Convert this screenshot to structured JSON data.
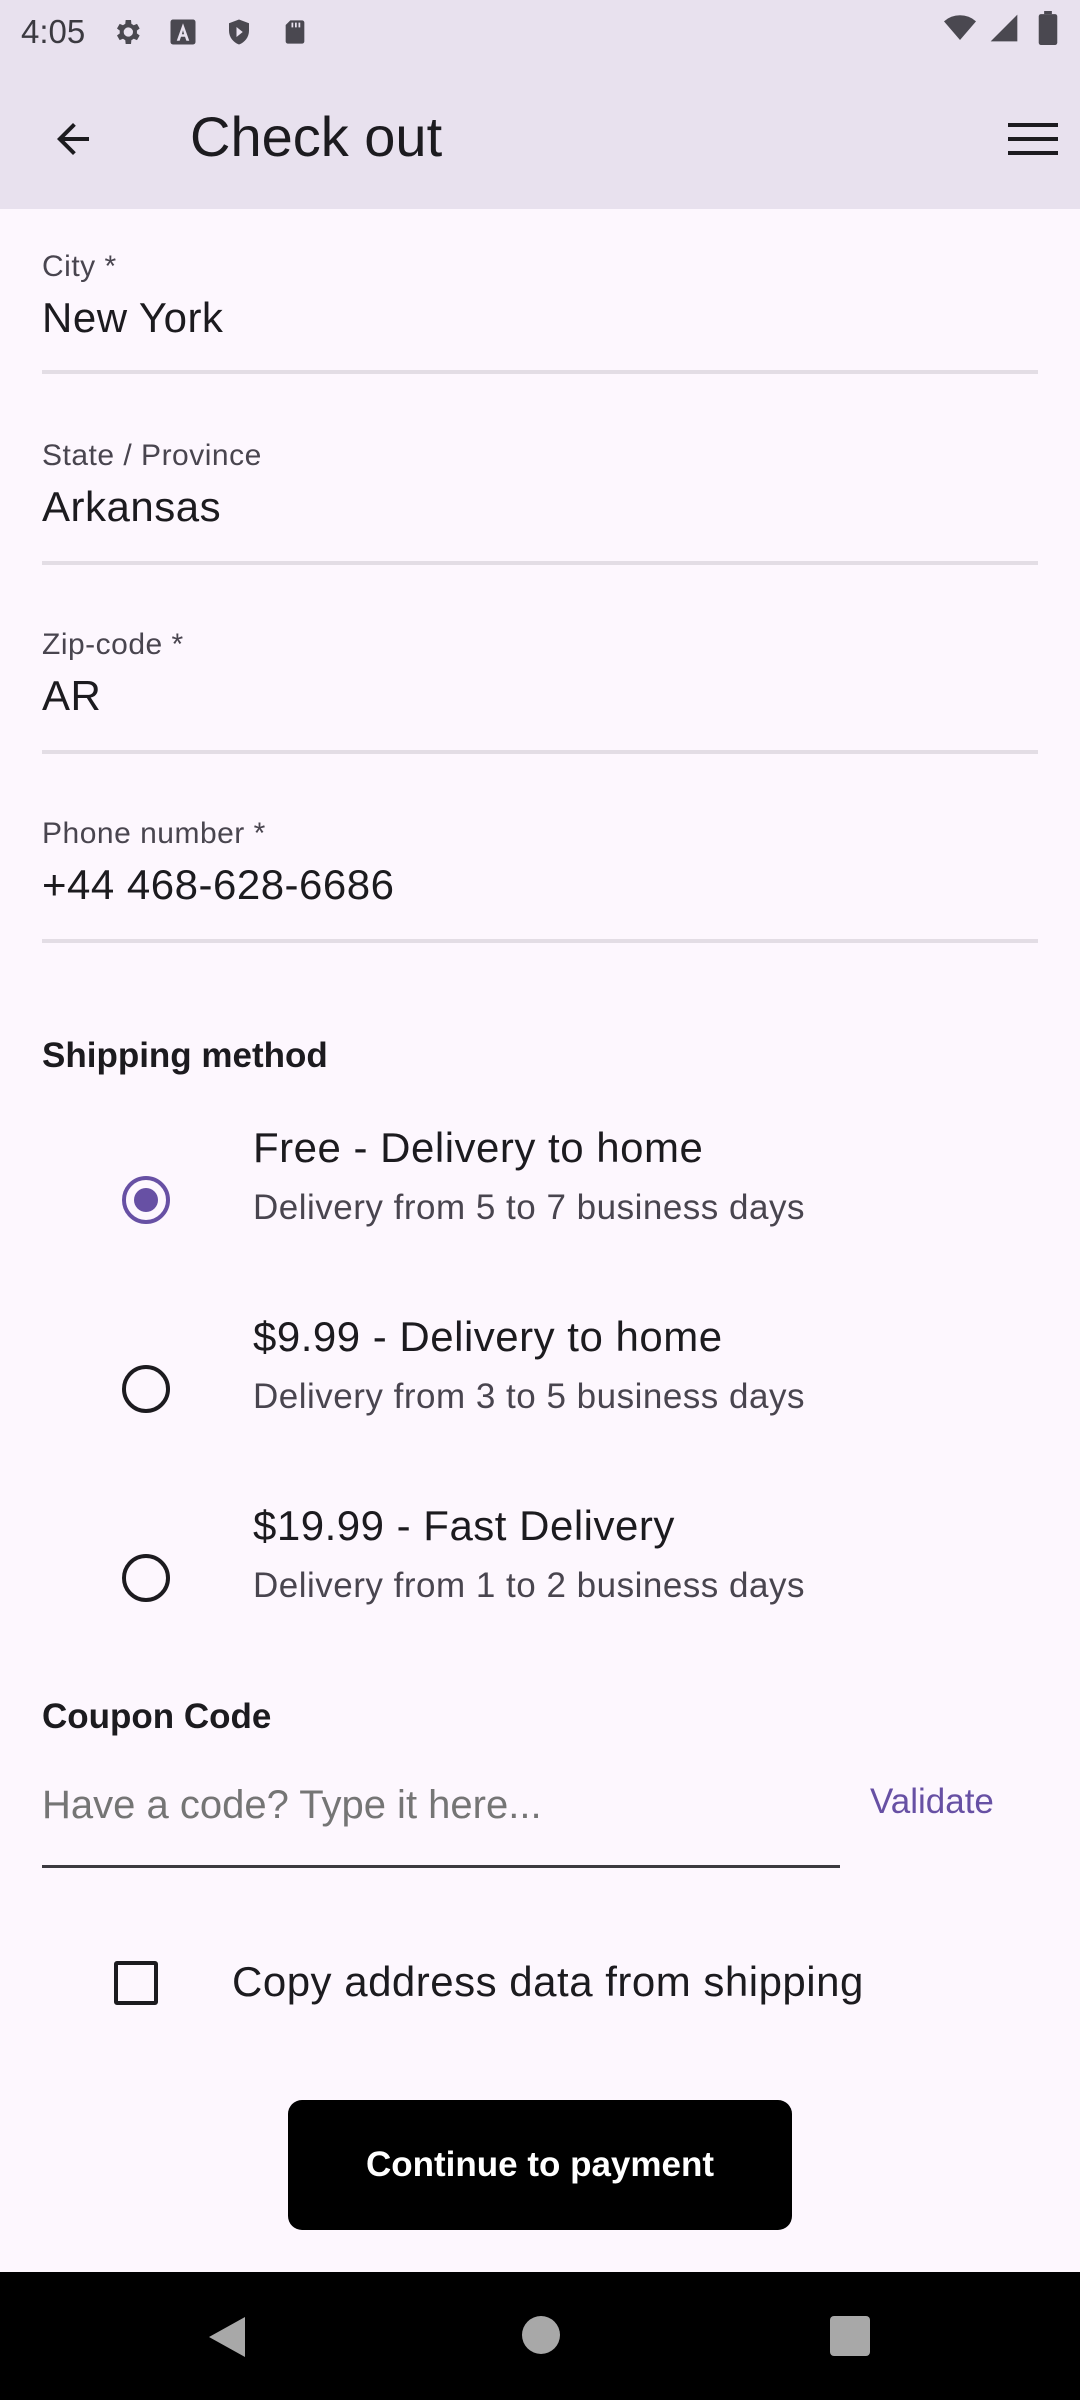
{
  "status_bar": {
    "time": "4:05",
    "left_icons": [
      "gear-icon",
      "font-a-icon",
      "shield-icon",
      "sd-card-icon"
    ],
    "right_icons": [
      "wifi-icon",
      "signal-icon",
      "battery-icon"
    ]
  },
  "app_bar": {
    "title": "Check out",
    "back_icon": "arrow-left-icon",
    "menu_icon": "hamburger-menu-icon"
  },
  "fields": {
    "city": {
      "label": "City *",
      "value": "New York"
    },
    "state": {
      "label": "State / Province",
      "value": "Arkansas"
    },
    "zip": {
      "label": "Zip-code *",
      "value": "AR"
    },
    "phone": {
      "label": "Phone number *",
      "value": "+44 468-628-6686"
    }
  },
  "shipping": {
    "title": "Shipping method",
    "options": [
      {
        "title": "Free - Delivery to home",
        "subtitle": "Delivery from 5 to 7 business days",
        "selected": true
      },
      {
        "title": "$9.99 - Delivery to home",
        "subtitle": "Delivery from 3 to 5 business days",
        "selected": false
      },
      {
        "title": "$19.99 - Fast Delivery",
        "subtitle": "Delivery from 1 to 2 business days",
        "selected": false
      }
    ]
  },
  "coupon": {
    "title": "Coupon Code",
    "placeholder": "Have a code? Type it here...",
    "validate_label": "Validate"
  },
  "copy_address": {
    "label": "Copy address data from shipping",
    "checked": false
  },
  "continue_label": "Continue to payment",
  "colors": {
    "accent": "#6750a4",
    "app_bar_bg": "#e8e1ee",
    "page_bg": "#fdf7fe",
    "button_bg": "#000000"
  }
}
